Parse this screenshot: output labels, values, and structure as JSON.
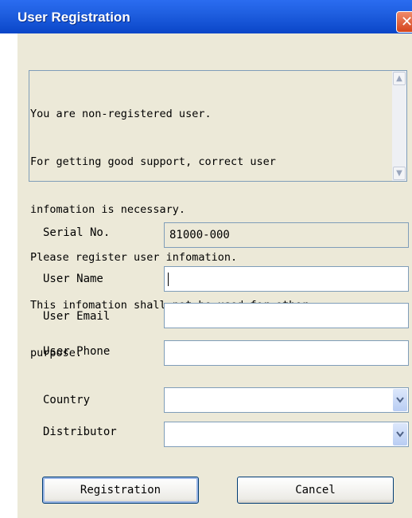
{
  "window": {
    "title": "User Registration",
    "close_glyph": "✕"
  },
  "message": {
    "lines": [
      "You are non-registered user.",
      "For getting good support, correct user",
      "infomation is necessary.",
      "Please register user infomation.",
      "This infomation shall not be used for other",
      "purpose."
    ]
  },
  "form": {
    "serial_label": "Serial No.",
    "serial_value": "81000-000",
    "name_label": "User Name",
    "name_value": "",
    "email_label": "User Email",
    "email_value": "",
    "phone_label": "User Phone",
    "phone_value": "",
    "country_label": "Country",
    "country_value": "",
    "distributor_label": "Distributor",
    "distributor_value": ""
  },
  "buttons": {
    "registration": "Registration",
    "cancel": "Cancel"
  },
  "icons": {
    "close": "close-icon",
    "scroll_up": "scroll-up-icon",
    "scroll_down": "scroll-down-icon",
    "dropdown": "chevron-down-icon"
  },
  "colors": {
    "titlebar": "#0a46c8",
    "dialog_bg": "#ece9d8",
    "field_border": "#7f9db9",
    "close": "#d4441c"
  }
}
